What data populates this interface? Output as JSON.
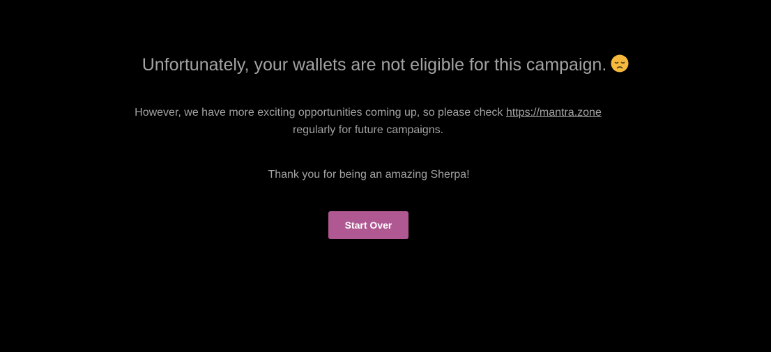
{
  "main": {
    "heading": "Unfortunately, your wallets are not eligible for this campaign.",
    "heading_icon": "disappointed-face-icon",
    "info_prefix": "However, we have more exciting opportunities coming up, so please check ",
    "info_link": "https://mantra.zone",
    "info_suffix": " regularly for future campaigns.",
    "thanks": "Thank you for being an amazing Sherpa!",
    "button_label": "Start Over"
  },
  "colors": {
    "background": "#000000",
    "text": "#a3a3a3",
    "button": "#b05892",
    "button_text": "#ffffff",
    "emoji": "#f6b93b"
  }
}
